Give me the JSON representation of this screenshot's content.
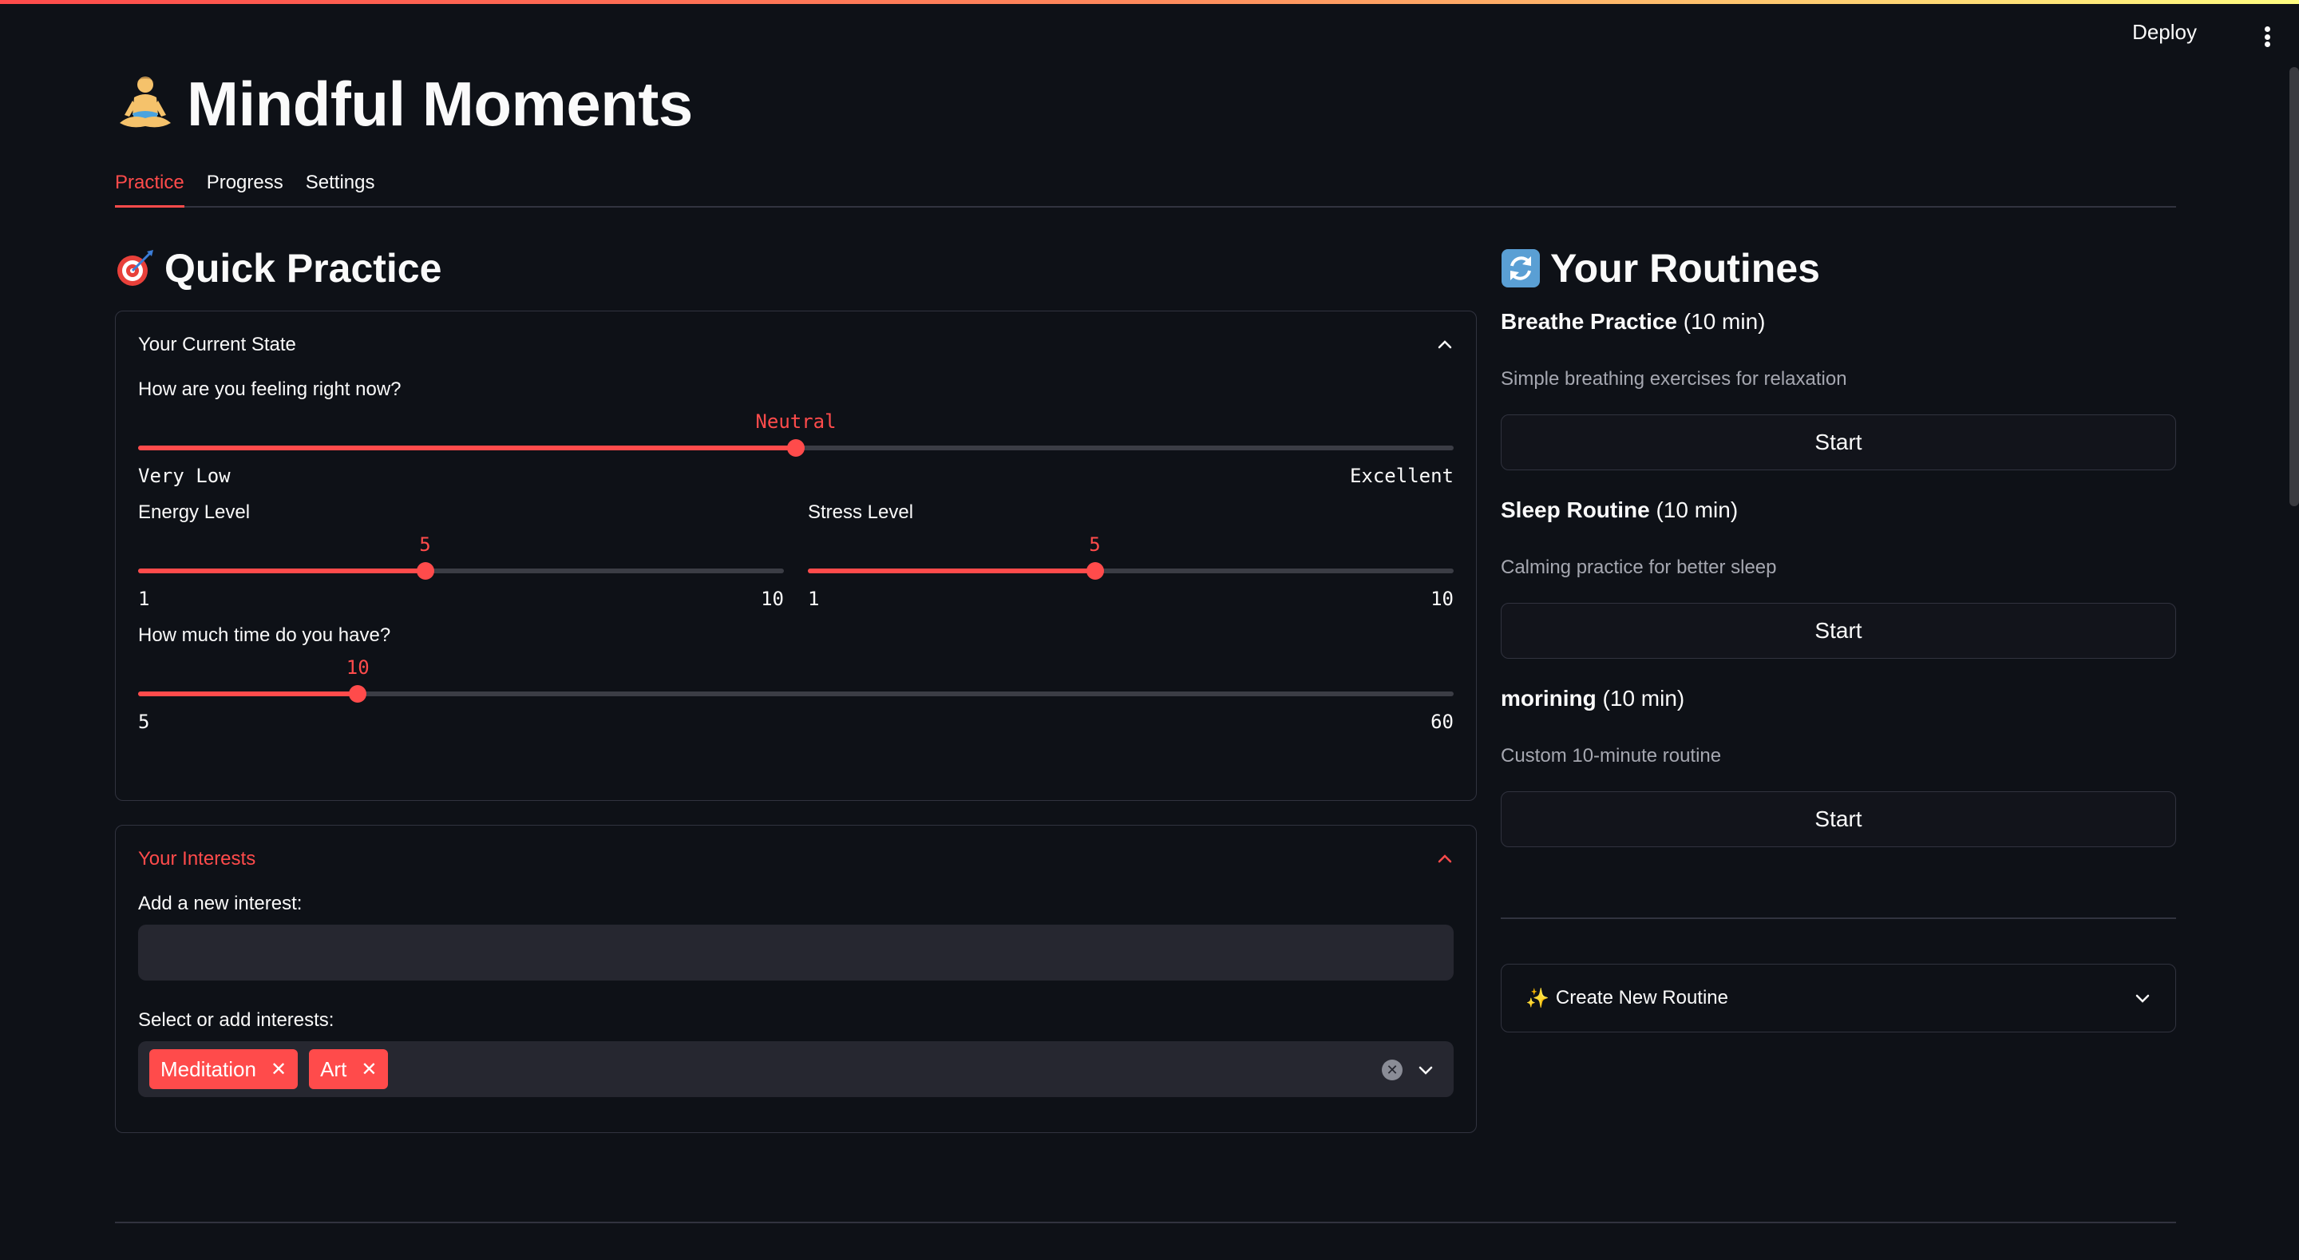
{
  "header": {
    "deploy_label": "Deploy"
  },
  "app": {
    "title": "Mindful Moments",
    "title_icon": "person-meditating-icon"
  },
  "tabs": [
    {
      "label": "Practice",
      "active": true
    },
    {
      "label": "Progress",
      "active": false
    },
    {
      "label": "Settings",
      "active": false
    }
  ],
  "quick_practice": {
    "heading": "Quick Practice",
    "heading_icon": "target-dart-icon",
    "current_state": {
      "title": "Your Current State",
      "feeling": {
        "label": "How are you feeling right now?",
        "value": "Neutral",
        "min_label": "Very Low",
        "max_label": "Excellent",
        "fraction": 0.5
      },
      "energy": {
        "label": "Energy Level",
        "value": "5",
        "min": "1",
        "max": "10",
        "fraction": 0.4444
      },
      "stress": {
        "label": "Stress Level",
        "value": "5",
        "min": "1",
        "max": "10",
        "fraction": 0.4444
      },
      "time": {
        "label": "How much time do you have?",
        "value": "10",
        "min": "5",
        "max": "60",
        "fraction": 0.0909
      }
    },
    "interests": {
      "title": "Your Interests",
      "add_label": "Add a new interest:",
      "add_value": "",
      "select_label": "Select or add interests:",
      "selected": [
        "Meditation",
        "Art"
      ]
    }
  },
  "routines": {
    "heading": "Your Routines",
    "heading_icon": "arrows-repeat-icon",
    "items": [
      {
        "name": "Breathe Practice",
        "duration": "(10 min)",
        "description": "Simple breathing exercises for relaxation",
        "button": "Start"
      },
      {
        "name": "Sleep Routine",
        "duration": "(10 min)",
        "description": "Calming practice for better sleep",
        "button": "Start"
      },
      {
        "name": "morining",
        "duration": "(10 min)",
        "description": "Custom 10-minute routine",
        "button": "Start"
      }
    ],
    "create_label": "Create New Routine",
    "create_icon": "sparkles-icon"
  },
  "colors": {
    "accent": "#ff4b4b",
    "background": "#0e1117",
    "widget_bg": "#262730",
    "border": "#31333f"
  }
}
